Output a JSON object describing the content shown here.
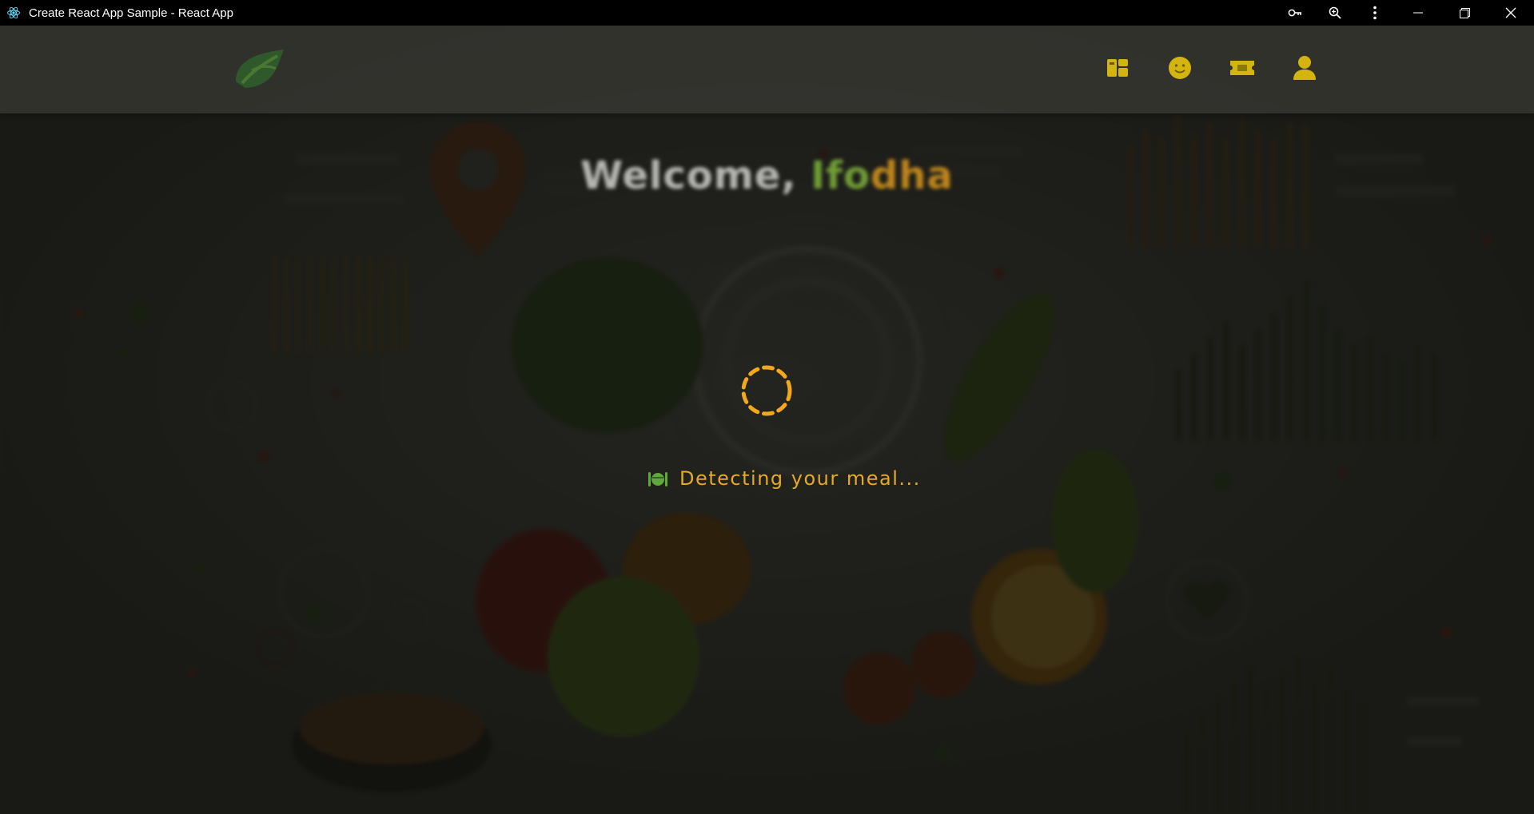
{
  "window": {
    "title": "Create React App Sample - React App"
  },
  "header": {
    "logo_icon": "leaf-logo-icon",
    "nav": [
      {
        "icon": "dashboard-icon"
      },
      {
        "icon": "smile-icon"
      },
      {
        "icon": "ticket-icon"
      },
      {
        "icon": "user-icon"
      }
    ]
  },
  "welcome": {
    "greeting": "Welcome, ",
    "name_part1": "Ifo",
    "name_part2": "dha"
  },
  "loader": {
    "icon": "meal-icon",
    "message": "Detecting your meal..."
  },
  "colors": {
    "accent_orange": "#f2a81d",
    "accent_green": "#8cc63f",
    "nav_icon": "#e8c21a"
  }
}
